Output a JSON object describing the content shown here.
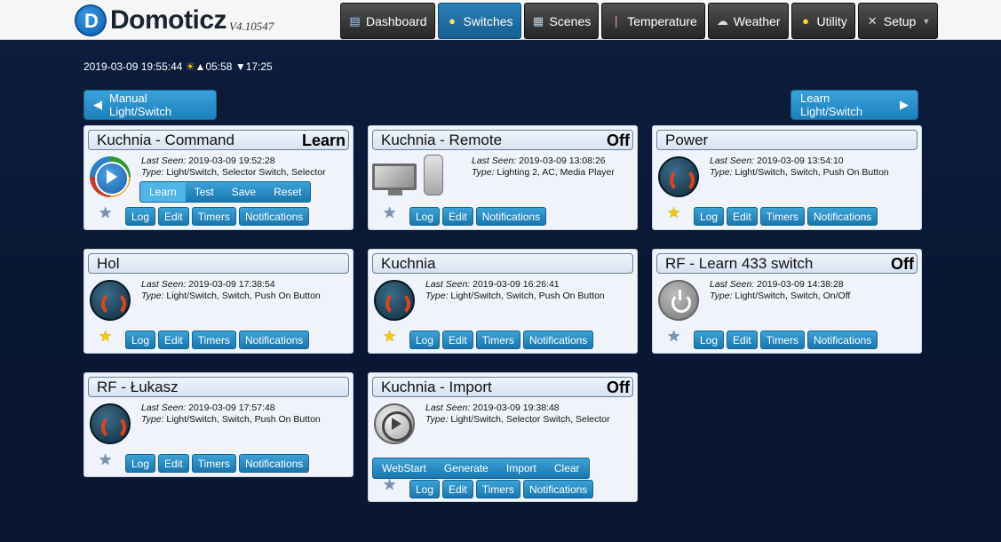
{
  "header": {
    "logo_text": "Domoticz",
    "version": "V4.10547",
    "nav": [
      {
        "label": "Dashboard",
        "icon": "dashboard-icon"
      },
      {
        "label": "Switches",
        "icon": "lightbulb-icon",
        "active": true
      },
      {
        "label": "Scenes",
        "icon": "clapperboard-icon"
      },
      {
        "label": "Temperature",
        "icon": "thermometer-icon"
      },
      {
        "label": "Weather",
        "icon": "cloud-icon"
      },
      {
        "label": "Utility",
        "icon": "bulb-icon"
      },
      {
        "label": "Setup",
        "icon": "tools-icon"
      }
    ]
  },
  "status": {
    "datetime": "2019-03-09 19:55:44",
    "sunrise": "05:58",
    "sunset": "17:25"
  },
  "actions": {
    "manual": "Manual Light/Switch",
    "learn": "Learn Light/Switch"
  },
  "labels": {
    "last_seen": "Last Seen:",
    "type": "Type:",
    "log": "Log",
    "edit": "Edit",
    "timers": "Timers",
    "notifications": "Notifications"
  },
  "devices": [
    {
      "name": "Kuchnia - Command",
      "status": "Learn",
      "last_seen": "2019-03-09 19:52:28",
      "type": "Light/Switch, Selector Switch, Selector",
      "selector": [
        "Learn",
        "Test",
        "Save",
        "Reset"
      ],
      "selected": "Learn",
      "favorite": false
    },
    {
      "name": "Kuchnia - Remote",
      "status": "Off",
      "last_seen": "2019-03-09 13:08:26",
      "type": "Lighting 2, AC, Media Player",
      "favorite": false
    },
    {
      "name": "Power",
      "status": "",
      "last_seen": "2019-03-09 13:54:10",
      "type": "Light/Switch, Switch, Push On Button",
      "favorite": true
    },
    {
      "name": "Hol",
      "status": "",
      "last_seen": "2019-03-09 17:38:54",
      "type": "Light/Switch, Switch, Push On Button",
      "favorite": true
    },
    {
      "name": "Kuchnia",
      "status": "",
      "last_seen": "2019-03-09 16:26:41",
      "type": "Light/Switch, Switch, Push On Button",
      "favorite": true
    },
    {
      "name": "RF - Learn 433 switch",
      "status": "Off",
      "last_seen": "2019-03-09 14:38:28",
      "type": "Light/Switch, Switch, On/Off",
      "favorite": false
    },
    {
      "name": "RF - Łukasz",
      "status": "",
      "last_seen": "2019-03-09 17:57:48",
      "type": "Light/Switch, Switch, Push On Button",
      "favorite": false
    },
    {
      "name": "Kuchnia - Import",
      "status": "Off",
      "last_seen": "2019-03-09 19:38:48",
      "type": "Light/Switch, Selector Switch, Selector",
      "selector": [
        "WebStart",
        "Generate",
        "Import",
        "Clear"
      ],
      "selected": "",
      "favorite": false
    }
  ]
}
